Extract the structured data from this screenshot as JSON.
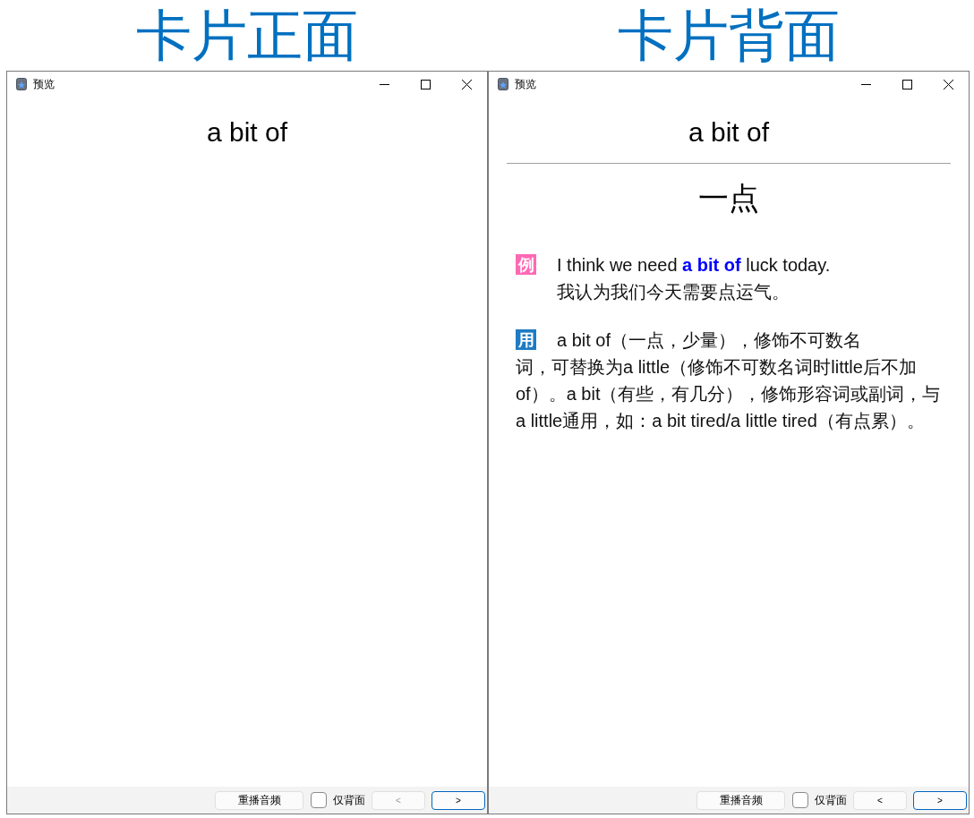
{
  "panels": [
    {
      "heading": "卡片正面",
      "window": {
        "title": "预览",
        "front": "a bit of",
        "controls": {
          "replay": "重播音频",
          "back_only": {
            "label": "仅背面",
            "checked": false
          },
          "prev": {
            "label": "<",
            "disabled": true
          },
          "next": {
            "label": ">",
            "disabled": false
          }
        }
      }
    },
    {
      "heading": "卡片背面",
      "window": {
        "title": "预览",
        "front": "a bit of",
        "back": {
          "meaning": "一点",
          "example": {
            "badge": "例",
            "en": "I think we need **a bit of** luck today.",
            "zh": "我认为我们今天需要点运气。"
          },
          "usage": {
            "badge": "用",
            "lead": "a bit of（一点，少量），修饰不可数名",
            "rest": "词，可替换为a little（修饰不可数名词时little后不加of）。a bit（有些，有几分），修饰形容词或副词，与a little通用，如：a bit tired/a little tired（有点累）。"
          }
        },
        "controls": {
          "replay": "重播音频",
          "back_only": {
            "label": "仅背面",
            "checked": false
          },
          "prev": {
            "label": "<",
            "disabled": false
          },
          "next": {
            "label": ">",
            "disabled": false
          }
        }
      }
    }
  ]
}
